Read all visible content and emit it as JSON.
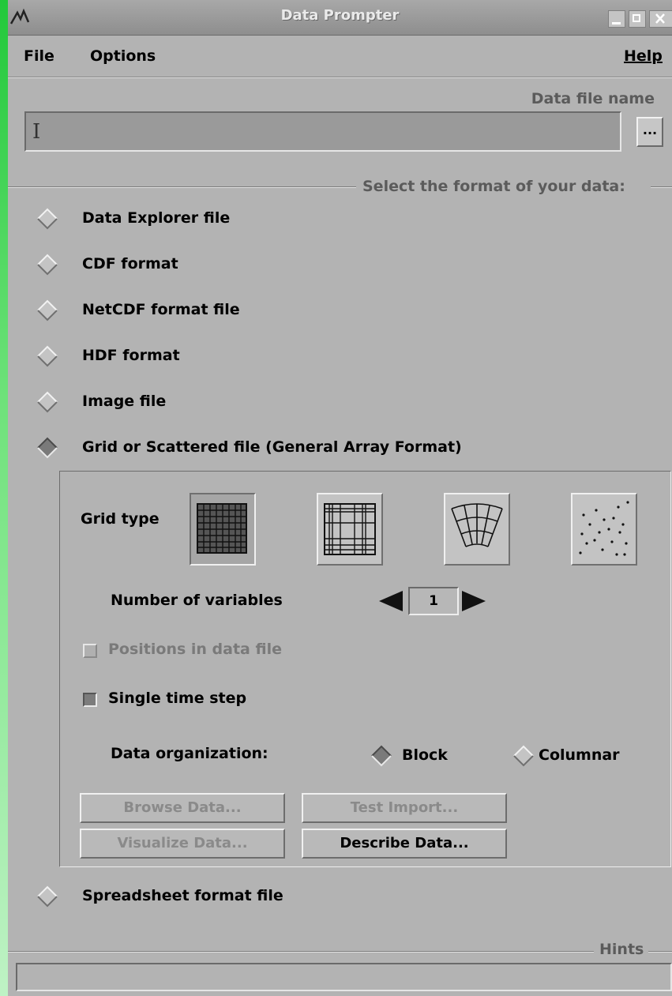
{
  "window": {
    "title": "Data Prompter"
  },
  "menu": {
    "file": "File",
    "options": "Options",
    "help": "Help"
  },
  "data_file": {
    "label": "Data file name",
    "value": "",
    "browse_label": "..."
  },
  "format_section": {
    "heading": "Select the format of your data:",
    "options": [
      {
        "label": "Data Explorer file",
        "selected": false
      },
      {
        "label": "CDF format",
        "selected": false
      },
      {
        "label": "NetCDF format file",
        "selected": false
      },
      {
        "label": "HDF format",
        "selected": false
      },
      {
        "label": "Image file",
        "selected": false
      },
      {
        "label": "Grid or Scattered file (General Array Format)",
        "selected": true
      },
      {
        "label": "Spreadsheet format file",
        "selected": false
      }
    ]
  },
  "general_array": {
    "grid_type_label": "Grid type",
    "grid_types": [
      "regular-grid-icon",
      "rectilinear-grid-icon",
      "curvilinear-grid-icon",
      "scattered-points-icon"
    ],
    "selected_grid_type": 0,
    "num_variables_label": "Number of variables",
    "num_variables": "1",
    "positions_label": "Positions in data file",
    "positions_enabled": false,
    "single_time_label": "Single time step",
    "single_time_checked": true,
    "data_org_label": "Data organization:",
    "data_org_options": [
      "Block",
      "Columnar"
    ],
    "data_org_selected": "Block",
    "buttons": {
      "browse": "Browse Data...",
      "test_import": "Test Import...",
      "visualize": "Visualize Data...",
      "describe": "Describe Data..."
    }
  },
  "hints": {
    "label": "Hints",
    "text": ""
  }
}
